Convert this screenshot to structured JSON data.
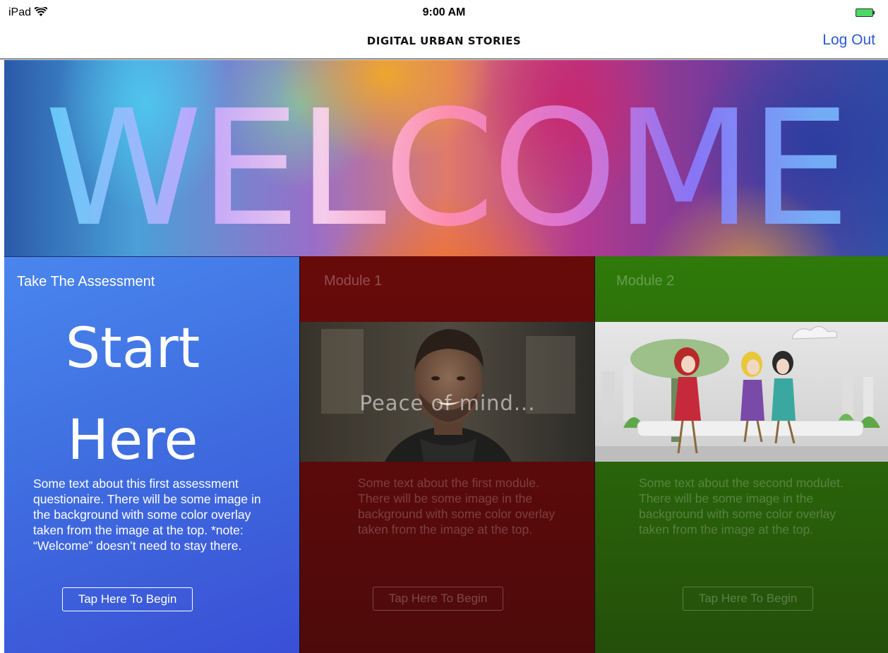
{
  "status_bar": {
    "device": "iPad",
    "time": "9:00 AM",
    "wifi_icon": "wifi-icon",
    "battery_icon": "battery-full-icon",
    "battery_color": "#4cd964"
  },
  "nav": {
    "title": "DIGITAL URBAN STORIES",
    "logout_label": "Log Out",
    "accent_color": "#2a5ad6"
  },
  "hero": {
    "text": "WELCOME"
  },
  "panels": [
    {
      "title": "Take The Assessment",
      "headline": [
        "Start",
        "Here"
      ],
      "description": "Some text about this first assessment questionaire. There will be some image in the background with some color overlay taken from the image at the top. *note: “Welcome” doesn’t need to stay there.",
      "button_label": "Tap Here To Begin",
      "color": "#4178e6"
    },
    {
      "title": "Module 1",
      "image_caption": "Peace of mind...",
      "description": "Some text about the first module. There will be some image in the background with some color overlay taken from the image at the top.",
      "button_label": "Tap Here To Begin",
      "color": "#5e0a0a"
    },
    {
      "title": "Module 2",
      "description": "Some text about the second modulet. There will be some image in the background with some color overlay taken from the image at the top.",
      "button_label": "Tap Here To Begin",
      "color": "#2f700a"
    }
  ]
}
